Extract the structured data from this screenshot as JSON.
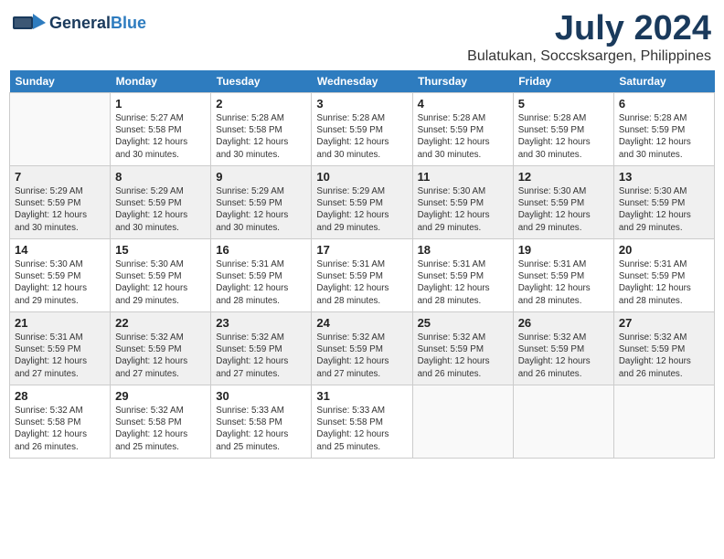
{
  "header": {
    "logo_general": "General",
    "logo_blue": "Blue",
    "month": "July 2024",
    "location": "Bulatukan, Soccsksargen, Philippines"
  },
  "weekdays": [
    "Sunday",
    "Monday",
    "Tuesday",
    "Wednesday",
    "Thursday",
    "Friday",
    "Saturday"
  ],
  "weeks": [
    [
      {
        "day": "",
        "info": ""
      },
      {
        "day": "1",
        "info": "Sunrise: 5:27 AM\nSunset: 5:58 PM\nDaylight: 12 hours\nand 30 minutes."
      },
      {
        "day": "2",
        "info": "Sunrise: 5:28 AM\nSunset: 5:58 PM\nDaylight: 12 hours\nand 30 minutes."
      },
      {
        "day": "3",
        "info": "Sunrise: 5:28 AM\nSunset: 5:59 PM\nDaylight: 12 hours\nand 30 minutes."
      },
      {
        "day": "4",
        "info": "Sunrise: 5:28 AM\nSunset: 5:59 PM\nDaylight: 12 hours\nand 30 minutes."
      },
      {
        "day": "5",
        "info": "Sunrise: 5:28 AM\nSunset: 5:59 PM\nDaylight: 12 hours\nand 30 minutes."
      },
      {
        "day": "6",
        "info": "Sunrise: 5:28 AM\nSunset: 5:59 PM\nDaylight: 12 hours\nand 30 minutes."
      }
    ],
    [
      {
        "day": "7",
        "info": "Sunrise: 5:29 AM\nSunset: 5:59 PM\nDaylight: 12 hours\nand 30 minutes."
      },
      {
        "day": "8",
        "info": "Sunrise: 5:29 AM\nSunset: 5:59 PM\nDaylight: 12 hours\nand 30 minutes."
      },
      {
        "day": "9",
        "info": "Sunrise: 5:29 AM\nSunset: 5:59 PM\nDaylight: 12 hours\nand 30 minutes."
      },
      {
        "day": "10",
        "info": "Sunrise: 5:29 AM\nSunset: 5:59 PM\nDaylight: 12 hours\nand 29 minutes."
      },
      {
        "day": "11",
        "info": "Sunrise: 5:30 AM\nSunset: 5:59 PM\nDaylight: 12 hours\nand 29 minutes."
      },
      {
        "day": "12",
        "info": "Sunrise: 5:30 AM\nSunset: 5:59 PM\nDaylight: 12 hours\nand 29 minutes."
      },
      {
        "day": "13",
        "info": "Sunrise: 5:30 AM\nSunset: 5:59 PM\nDaylight: 12 hours\nand 29 minutes."
      }
    ],
    [
      {
        "day": "14",
        "info": "Sunrise: 5:30 AM\nSunset: 5:59 PM\nDaylight: 12 hours\nand 29 minutes."
      },
      {
        "day": "15",
        "info": "Sunrise: 5:30 AM\nSunset: 5:59 PM\nDaylight: 12 hours\nand 29 minutes."
      },
      {
        "day": "16",
        "info": "Sunrise: 5:31 AM\nSunset: 5:59 PM\nDaylight: 12 hours\nand 28 minutes."
      },
      {
        "day": "17",
        "info": "Sunrise: 5:31 AM\nSunset: 5:59 PM\nDaylight: 12 hours\nand 28 minutes."
      },
      {
        "day": "18",
        "info": "Sunrise: 5:31 AM\nSunset: 5:59 PM\nDaylight: 12 hours\nand 28 minutes."
      },
      {
        "day": "19",
        "info": "Sunrise: 5:31 AM\nSunset: 5:59 PM\nDaylight: 12 hours\nand 28 minutes."
      },
      {
        "day": "20",
        "info": "Sunrise: 5:31 AM\nSunset: 5:59 PM\nDaylight: 12 hours\nand 28 minutes."
      }
    ],
    [
      {
        "day": "21",
        "info": "Sunrise: 5:31 AM\nSunset: 5:59 PM\nDaylight: 12 hours\nand 27 minutes."
      },
      {
        "day": "22",
        "info": "Sunrise: 5:32 AM\nSunset: 5:59 PM\nDaylight: 12 hours\nand 27 minutes."
      },
      {
        "day": "23",
        "info": "Sunrise: 5:32 AM\nSunset: 5:59 PM\nDaylight: 12 hours\nand 27 minutes."
      },
      {
        "day": "24",
        "info": "Sunrise: 5:32 AM\nSunset: 5:59 PM\nDaylight: 12 hours\nand 27 minutes."
      },
      {
        "day": "25",
        "info": "Sunrise: 5:32 AM\nSunset: 5:59 PM\nDaylight: 12 hours\nand 26 minutes."
      },
      {
        "day": "26",
        "info": "Sunrise: 5:32 AM\nSunset: 5:59 PM\nDaylight: 12 hours\nand 26 minutes."
      },
      {
        "day": "27",
        "info": "Sunrise: 5:32 AM\nSunset: 5:59 PM\nDaylight: 12 hours\nand 26 minutes."
      }
    ],
    [
      {
        "day": "28",
        "info": "Sunrise: 5:32 AM\nSunset: 5:58 PM\nDaylight: 12 hours\nand 26 minutes."
      },
      {
        "day": "29",
        "info": "Sunrise: 5:32 AM\nSunset: 5:58 PM\nDaylight: 12 hours\nand 25 minutes."
      },
      {
        "day": "30",
        "info": "Sunrise: 5:33 AM\nSunset: 5:58 PM\nDaylight: 12 hours\nand 25 minutes."
      },
      {
        "day": "31",
        "info": "Sunrise: 5:33 AM\nSunset: 5:58 PM\nDaylight: 12 hours\nand 25 minutes."
      },
      {
        "day": "",
        "info": ""
      },
      {
        "day": "",
        "info": ""
      },
      {
        "day": "",
        "info": ""
      }
    ]
  ]
}
